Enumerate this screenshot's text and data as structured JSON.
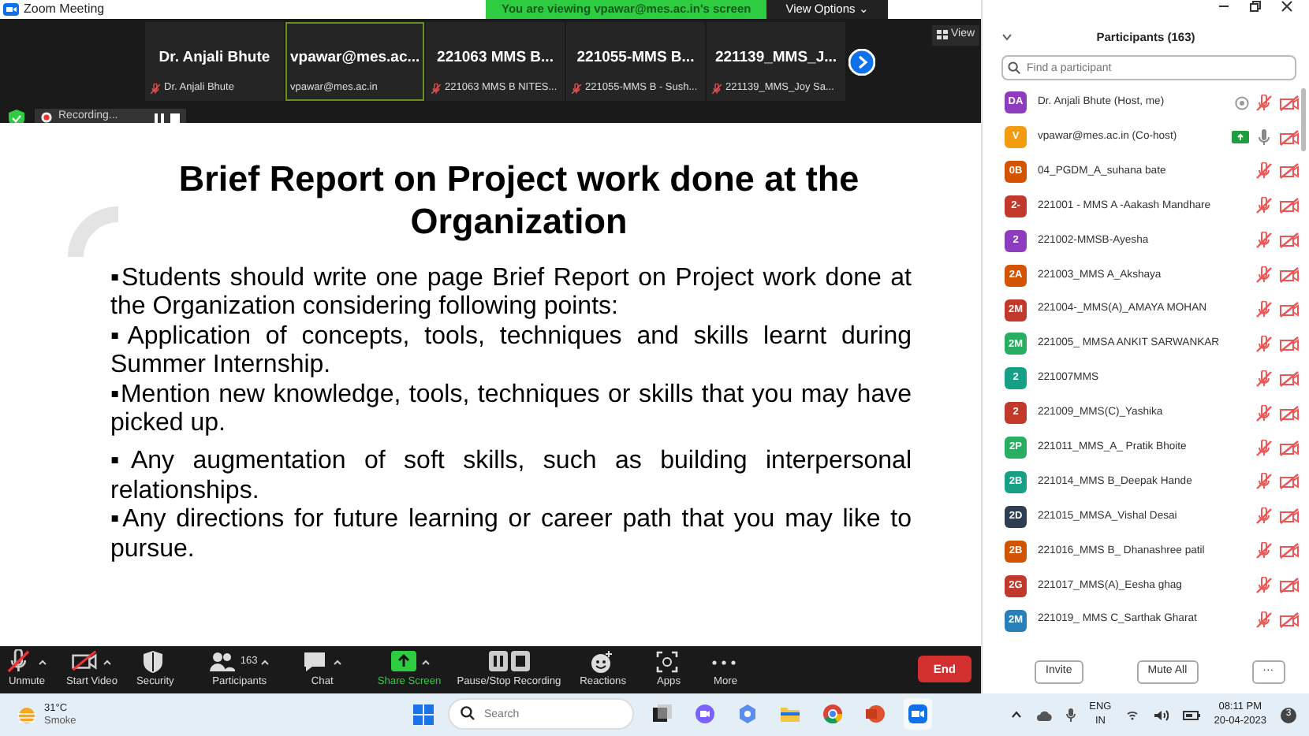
{
  "window": {
    "title": "Zoom Meeting"
  },
  "banner": {
    "text": "You are viewing vpawar@mes.ac.in's screen",
    "options": "View Options ⌄"
  },
  "view_button": "View",
  "tiles": [
    {
      "big_name": "Dr. Anjali Bhute",
      "label": "Dr. Anjali Bhute",
      "muted": true,
      "selected": false
    },
    {
      "big_name": "vpawar@mes.ac...",
      "label": "vpawar@mes.ac.in",
      "muted": false,
      "selected": true
    },
    {
      "big_name": "221063  MMS B...",
      "label": "221063 MMS B NITES...",
      "muted": true,
      "selected": false
    },
    {
      "big_name": "221055-MMS  B...",
      "label": "221055-MMS B - Sush...",
      "muted": true,
      "selected": false
    },
    {
      "big_name": "221139_MMS_J...",
      "label": "221139_MMS_Joy Sa...",
      "muted": true,
      "selected": false
    }
  ],
  "recording": {
    "label": "Recording..."
  },
  "slide": {
    "title": "Brief Report on Project  work done at the Organization",
    "bullets": [
      "▪Students should write one page Brief Report on Project work done at the Organization considering following points:",
      "▪Application of concepts, tools, techniques and skills learnt during Summer Internship.",
      "▪Mention new knowledge, tools, techniques or skills that you  may have picked up.",
      "▪Any augmentation of soft skills, such as building interpersonal relationships.",
      "▪Any directions for future learning or career path that you may  like to pursue."
    ]
  },
  "toolbar": [
    {
      "kind": "mic",
      "label": "Unmute",
      "caret": true
    },
    {
      "kind": "video",
      "label": "Start Video",
      "caret": true
    },
    {
      "kind": "security",
      "label": "Security",
      "caret": false
    },
    {
      "kind": "participants",
      "label": "Participants",
      "count": "163",
      "caret": true
    },
    {
      "kind": "chat",
      "label": "Chat",
      "caret": true
    },
    {
      "kind": "share",
      "label": "Share Screen",
      "caret": true
    },
    {
      "kind": "record",
      "label": "Pause/Stop Recording",
      "caret": false
    },
    {
      "kind": "reactions",
      "label": "Reactions",
      "caret": false
    },
    {
      "kind": "apps",
      "label": "Apps",
      "caret": false
    },
    {
      "kind": "more",
      "label": "More",
      "caret": false
    }
  ],
  "end_button": "End",
  "participants_panel": {
    "title": "Participants (163)",
    "search": {
      "placeholder": "Find a participant"
    },
    "items": [
      {
        "initials": "DA",
        "color": "#8e3cbf",
        "name": "Dr. Anjali Bhute (Host, me)",
        "recording": true,
        "sharing": false,
        "mic_muted": true
      },
      {
        "initials": "V",
        "color": "#f39c12",
        "name": "vpawar@mes.ac.in (Co-host)",
        "recording": false,
        "sharing": true,
        "mic_muted": false
      },
      {
        "initials": "0B",
        "color": "#d35400",
        "name": "04_PGDM_A_suhana bate",
        "recording": false,
        "sharing": false,
        "mic_muted": true
      },
      {
        "initials": "2-",
        "color": "#c0392b",
        "name": "221001 - MMS A -Aakash Mandhare",
        "recording": false,
        "sharing": false,
        "mic_muted": true
      },
      {
        "initials": "2",
        "color": "#8e3cbf",
        "name": "221002-MMSB-Ayesha",
        "recording": false,
        "sharing": false,
        "mic_muted": true
      },
      {
        "initials": "2A",
        "color": "#d35400",
        "name": "221003_MMS A_Akshaya",
        "recording": false,
        "sharing": false,
        "mic_muted": true
      },
      {
        "initials": "2M",
        "color": "#c0392b",
        "name": "221004-_MMS(A)_AMAYA MOHAN",
        "recording": false,
        "sharing": false,
        "mic_muted": true
      },
      {
        "initials": "2M",
        "color": "#27ae60",
        "name": "221005_ MMSA ANKIT SARWANKAR",
        "recording": false,
        "sharing": false,
        "mic_muted": true
      },
      {
        "initials": "2",
        "color": "#16a085",
        "name": "221007MMS",
        "recording": false,
        "sharing": false,
        "mic_muted": true
      },
      {
        "initials": "2",
        "color": "#c0392b",
        "name": "221009_MMS(C)_Yashika",
        "recording": false,
        "sharing": false,
        "mic_muted": true
      },
      {
        "initials": "2P",
        "color": "#27ae60",
        "name": "221011_MMS_A_ Pratik Bhoite",
        "recording": false,
        "sharing": false,
        "mic_muted": true
      },
      {
        "initials": "2B",
        "color": "#16a085",
        "name": "221014_MMS B_Deepak Hande",
        "recording": false,
        "sharing": false,
        "mic_muted": true
      },
      {
        "initials": "2D",
        "color": "#2c3e50",
        "name": "221015_MMSA_Vishal Desai",
        "recording": false,
        "sharing": false,
        "mic_muted": true
      },
      {
        "initials": "2B",
        "color": "#d35400",
        "name": "221016_MMS B_ Dhanashree patil",
        "recording": false,
        "sharing": false,
        "mic_muted": true
      },
      {
        "initials": "2G",
        "color": "#c0392b",
        "name": "221017_MMS(A)_Eesha ghag",
        "recording": false,
        "sharing": false,
        "mic_muted": true
      },
      {
        "initials": "2M",
        "color": "#2980b9",
        "name": "221019_ MMS C_Sarthak Gharat",
        "recording": false,
        "sharing": false,
        "mic_muted": true
      }
    ],
    "buttons": [
      "Invite",
      "Mute All"
    ],
    "more": "···"
  },
  "taskbar": {
    "weather": {
      "temp": "31°C",
      "condition": "Smoke"
    },
    "search": {
      "placeholder": "Search"
    },
    "apps": [
      {
        "kind": "taskview"
      },
      {
        "kind": "chat"
      },
      {
        "kind": "copilot"
      },
      {
        "kind": "folder"
      },
      {
        "kind": "chrome"
      },
      {
        "kind": "powerpoint"
      },
      {
        "kind": "zoom",
        "active": true
      }
    ],
    "language": [
      "ENG",
      "IN"
    ],
    "time": "08:11 PM",
    "date": "20-04-2023",
    "notifications": "3"
  }
}
